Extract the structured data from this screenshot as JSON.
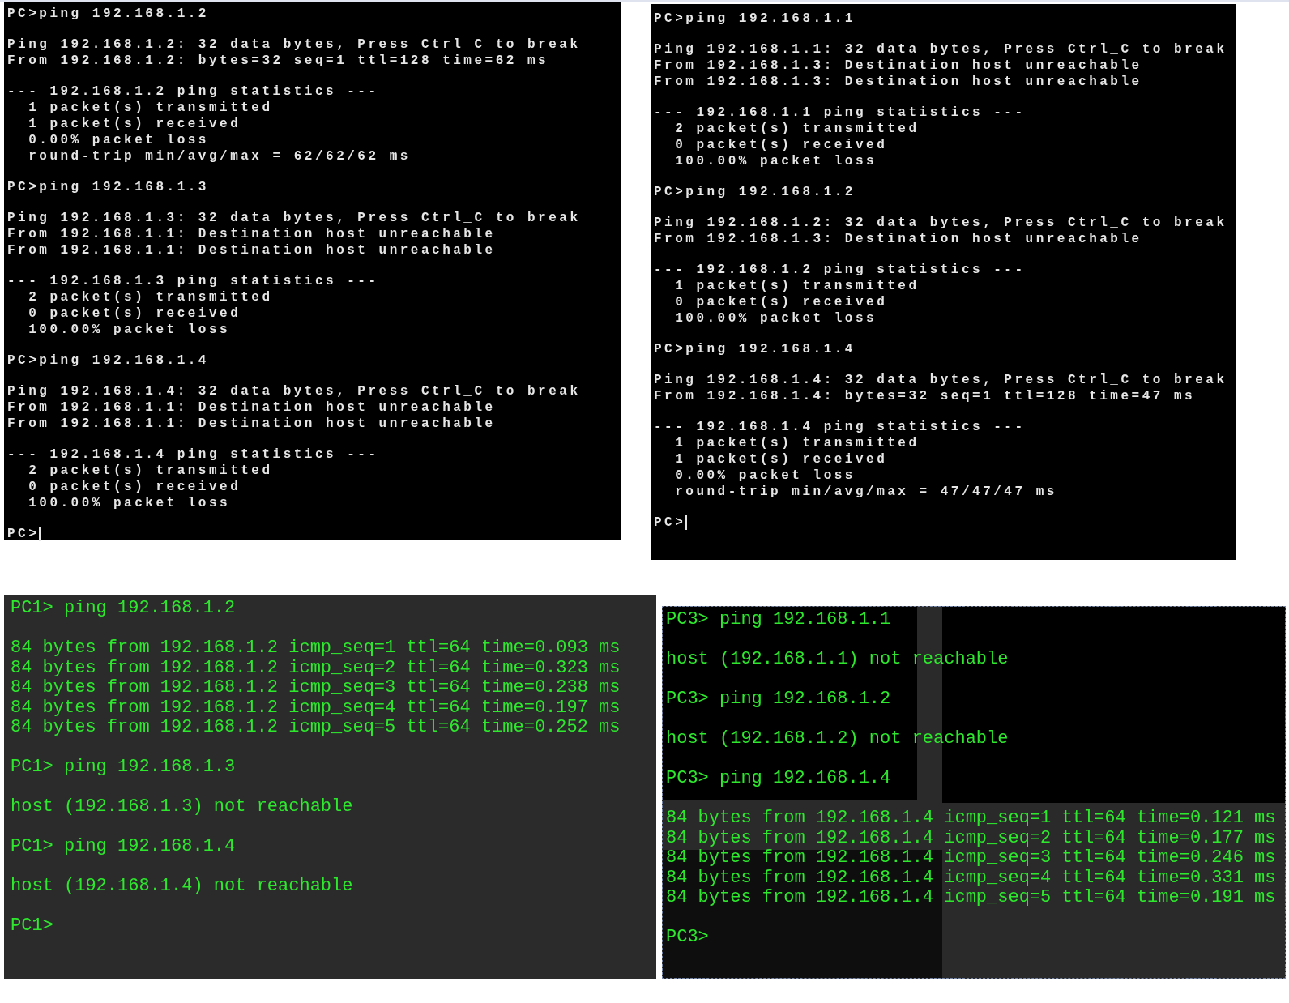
{
  "panels": [
    {
      "kind": "classic",
      "cursor": true,
      "blocks": [
        [
          "PC>ping 192.168.1.2"
        ],
        [
          "Ping 192.168.1.2: 32 data bytes, Press Ctrl_C to break",
          "From 192.168.1.2: bytes=32 seq=1 ttl=128 time=62 ms"
        ],
        [
          "--- 192.168.1.2 ping statistics ---",
          "  1 packet(s) transmitted",
          "  1 packet(s) received",
          "  0.00% packet loss",
          "  round-trip min/avg/max = 62/62/62 ms"
        ],
        [
          "PC>ping 192.168.1.3"
        ],
        [
          "Ping 192.168.1.3: 32 data bytes, Press Ctrl_C to break",
          "From 192.168.1.1: Destination host unreachable",
          "From 192.168.1.1: Destination host unreachable"
        ],
        [
          "--- 192.168.1.3 ping statistics ---",
          "  2 packet(s) transmitted",
          "  0 packet(s) received",
          "  100.00% packet loss"
        ],
        [
          "PC>ping 192.168.1.4"
        ],
        [
          "Ping 192.168.1.4: 32 data bytes, Press Ctrl_C to break",
          "From 192.168.1.1: Destination host unreachable",
          "From 192.168.1.1: Destination host unreachable"
        ],
        [
          "--- 192.168.1.4 ping statistics ---",
          "  2 packet(s) transmitted",
          "  0 packet(s) received",
          "  100.00% packet loss"
        ],
        [
          "PC>"
        ]
      ]
    },
    {
      "kind": "classic",
      "cursor": true,
      "blocks": [
        [
          "PC>ping 192.168.1.1"
        ],
        [
          "Ping 192.168.1.1: 32 data bytes, Press Ctrl_C to break",
          "From 192.168.1.3: Destination host unreachable",
          "From 192.168.1.3: Destination host unreachable"
        ],
        [
          "--- 192.168.1.1 ping statistics ---",
          "  2 packet(s) transmitted",
          "  0 packet(s) received",
          "  100.00% packet loss"
        ],
        [
          "PC>ping 192.168.1.2"
        ],
        [
          "Ping 192.168.1.2: 32 data bytes, Press Ctrl_C to break",
          "From 192.168.1.3: Destination host unreachable"
        ],
        [
          "--- 192.168.1.2 ping statistics ---",
          "  1 packet(s) transmitted",
          "  0 packet(s) received",
          "  100.00% packet loss"
        ],
        [
          "PC>ping 192.168.1.4"
        ],
        [
          "Ping 192.168.1.4: 32 data bytes, Press Ctrl_C to break",
          "From 192.168.1.4: bytes=32 seq=1 ttl=128 time=47 ms"
        ],
        [
          "--- 192.168.1.4 ping statistics ---",
          "  1 packet(s) transmitted",
          "  1 packet(s) received",
          "  0.00% packet loss",
          "  round-trip min/avg/max = 47/47/47 ms"
        ],
        [
          "PC>"
        ]
      ]
    },
    {
      "kind": "vpcs",
      "cursor": false,
      "blocks": [
        [
          "PC1> ping 192.168.1.2"
        ],
        [
          "84 bytes from 192.168.1.2 icmp_seq=1 ttl=64 time=0.093 ms",
          "84 bytes from 192.168.1.2 icmp_seq=2 ttl=64 time=0.323 ms",
          "84 bytes from 192.168.1.2 icmp_seq=3 ttl=64 time=0.238 ms",
          "84 bytes from 192.168.1.2 icmp_seq=4 ttl=64 time=0.197 ms",
          "84 bytes from 192.168.1.2 icmp_seq=5 ttl=64 time=0.252 ms"
        ],
        [
          "PC1> ping 192.168.1.3"
        ],
        [
          "host (192.168.1.3) not reachable"
        ],
        [
          "PC1> ping 192.168.1.4"
        ],
        [
          "host (192.168.1.4) not reachable"
        ],
        [
          "PC1>"
        ]
      ]
    },
    {
      "kind": "vpcs",
      "cursor": false,
      "blocks": [
        [
          "PC3> ping 192.168.1.1"
        ],
        [
          "host (192.168.1.1) not reachable"
        ],
        [
          "PC3> ping 192.168.1.2"
        ],
        [
          "host (192.168.1.2) not reachable"
        ],
        [
          "PC3> ping 192.168.1.4"
        ],
        [
          "84 bytes from 192.168.1.4 icmp_seq=1 ttl=64 time=0.121 ms",
          "84 bytes from 192.168.1.4 icmp_seq=2 ttl=64 time=0.177 ms",
          "84 bytes from 192.168.1.4 icmp_seq=3 ttl=64 time=0.246 ms",
          "84 bytes from 192.168.1.4 icmp_seq=4 ttl=64 time=0.331 ms",
          "84 bytes from 192.168.1.4 icmp_seq=5 ttl=64 time=0.191 ms"
        ],
        [
          "PC3>"
        ]
      ]
    }
  ]
}
